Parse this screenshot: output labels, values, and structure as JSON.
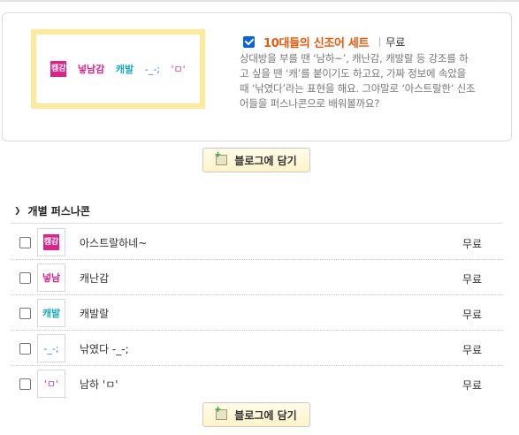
{
  "set": {
    "checked": true,
    "title": "10대들의 신조어 세트",
    "price": "무료",
    "description": "상대방을 부를 땐 ‘남하~’, 캐난감, 캐발랄 등 강조를 하고 싶을 땐 ‘캐’를 붙이기도 하고요, 가짜 정보에 속았을 때 ‘낚였다’라는 표현을 해요. 그야말로 ‘아스트랄한’ 신조어들을 퍼스나콘으로 배워볼까요?",
    "preview_emoticons": [
      "캠감",
      "넣남감",
      "캐발",
      "-_-;",
      "'ㅁ'"
    ]
  },
  "add_button_label": "블로그에 담기",
  "section": {
    "title": "개별 퍼스나콘",
    "items": [
      {
        "name": "아스트랄하네~",
        "price": "무료",
        "icon": "캠감"
      },
      {
        "name": "캐난감",
        "price": "무료",
        "icon": "넣남"
      },
      {
        "name": "캐발랄",
        "price": "무료",
        "icon": "캐발"
      },
      {
        "name": "낚였다 -_-;",
        "price": "무료",
        "icon": "-_-;"
      },
      {
        "name": "남하 'ㅁ'",
        "price": "무료",
        "icon": "'ㅁ'"
      }
    ]
  }
}
